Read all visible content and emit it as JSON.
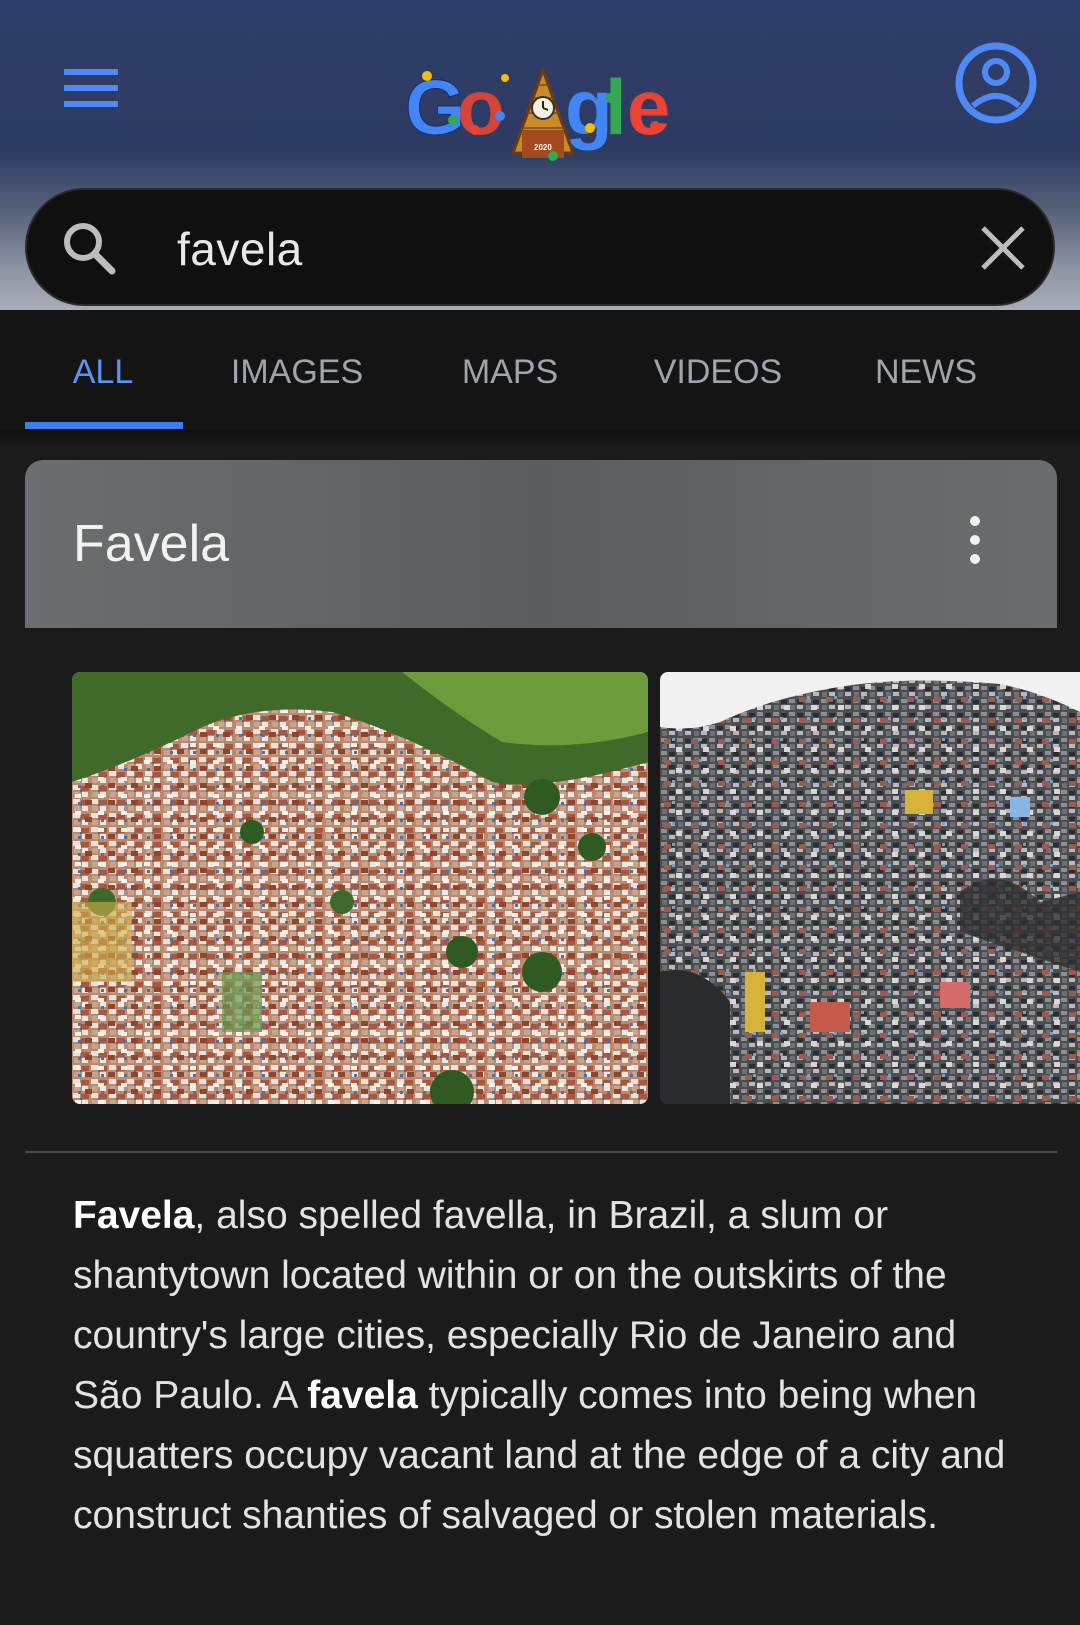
{
  "header": {
    "logo_text": "Google",
    "logo_doodle_year": "2020",
    "colors": {
      "accent": "#4f8af4",
      "background": "#2f3e6a"
    }
  },
  "search": {
    "query": "favela",
    "icons": {
      "search": "search-icon",
      "clear": "close-icon",
      "menu": "menu-icon",
      "account": "account-circle-icon"
    }
  },
  "tabs": [
    {
      "label": "ALL",
      "active": true
    },
    {
      "label": "IMAGES",
      "active": false
    },
    {
      "label": "MAPS",
      "active": false
    },
    {
      "label": "VIDEOS",
      "active": false
    },
    {
      "label": "NEWS",
      "active": false
    }
  ],
  "knowledge_panel": {
    "title": "Favela",
    "more_icon": "more-vert-icon",
    "images": [
      {
        "name": "favela-aerial-photo"
      },
      {
        "name": "favela-hillside-photo"
      }
    ],
    "description": {
      "term1": "Favela",
      "part1": ", also spelled favella, in Brazil, a slum or shantytown located within or on the outskirts of the country's large cities, especially Rio de Janeiro and São Paulo. A ",
      "term2": "favela",
      "part2": " typically comes into being when squatters occupy vacant land at the edge of a city and construct shanties of salvaged or stolen materials."
    }
  }
}
